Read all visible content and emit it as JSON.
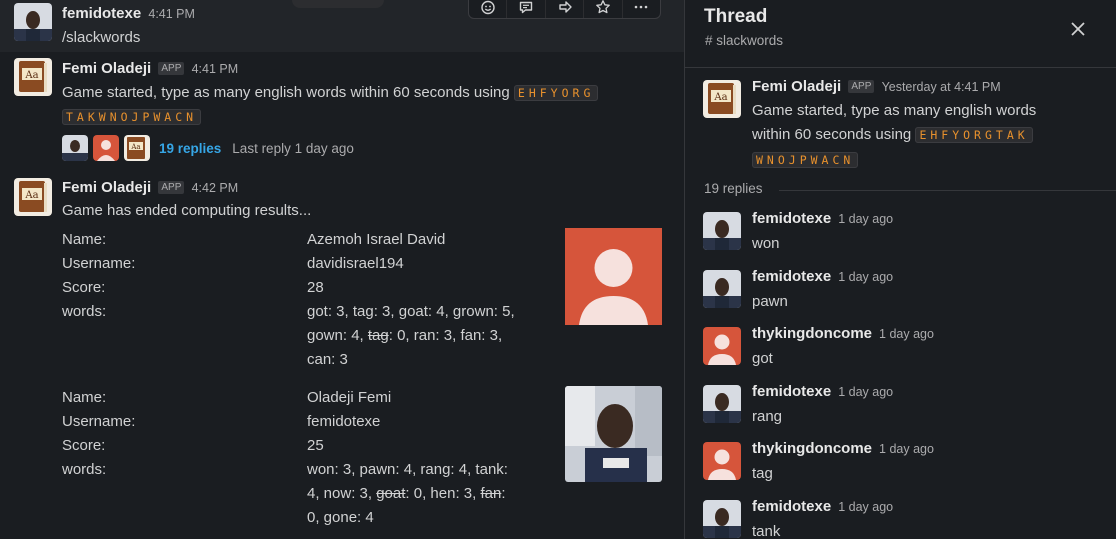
{
  "channel_messages": [
    {
      "sender": "femidotexe",
      "timestamp": "4:41 PM",
      "text": "/slackwords"
    },
    {
      "sender": "Femi Oladeji",
      "badge": "APP",
      "timestamp": "4:41 PM",
      "text": "Game started, type as many english words within 60 seconds using",
      "letters_line1": "EHFYORG",
      "letters_line2": "TAKWNOJPWACN",
      "replies_label": "19 replies",
      "last_reply": "Last reply 1 day ago"
    },
    {
      "sender": "Femi Oladeji",
      "badge": "APP",
      "timestamp": "4:42 PM",
      "text": "Game has ended computing results..."
    }
  ],
  "results": [
    {
      "name_label": "Name:",
      "username_label": "Username:",
      "score_label": "Score:",
      "words_label": "words:",
      "name": "Azemoh Israel David",
      "username": "davidisrael194",
      "score": "28",
      "words_l1": "got: 3, tag: 3, goat: 4, grown: 5,",
      "words_l2a": "gown: 4, ",
      "words_l2_strike": "tag",
      "words_l2b": ": 0, ran: 3, fan: 3,",
      "words_l3": "can: 3"
    },
    {
      "name_label": "Name:",
      "username_label": "Username:",
      "score_label": "Score:",
      "words_label": "words:",
      "name": "Oladeji Femi",
      "username": "femidotexe",
      "score": "25",
      "words_l1": "won: 3, pawn: 4, rang: 4, tank:",
      "words_l2a": "4, now: 3, ",
      "words_l2_strike": "goat",
      "words_l2b": ": 0, hen: 3, ",
      "words_l2_strike2": "fan",
      "words_l2c": ":",
      "words_l3": "0, gone: 4"
    }
  ],
  "thread": {
    "title": "Thread",
    "channel": "# slackwords",
    "parent": {
      "sender": "Femi Oladeji",
      "badge": "APP",
      "timestamp": "Yesterday at 4:41 PM",
      "text_l1": "Game started, type as many english words",
      "text_l2": "within 60 seconds using",
      "letters_line1": "EHFYORGTAK",
      "letters_line2": "WNOJPWACN"
    },
    "replies_count": "19 replies",
    "replies": [
      {
        "sender": "femidotexe",
        "timestamp": "1 day ago",
        "text": "won",
        "avatar": "photo"
      },
      {
        "sender": "femidotexe",
        "timestamp": "1 day ago",
        "text": "pawn",
        "avatar": "photo"
      },
      {
        "sender": "thykingdoncome",
        "timestamp": "1 day ago",
        "text": "got",
        "avatar": "default"
      },
      {
        "sender": "femidotexe",
        "timestamp": "1 day ago",
        "text": "rang",
        "avatar": "photo"
      },
      {
        "sender": "thykingdoncome",
        "timestamp": "1 day ago",
        "text": "tag",
        "avatar": "default"
      },
      {
        "sender": "femidotexe",
        "timestamp": "1 day ago",
        "text": "tank",
        "avatar": "photo"
      }
    ]
  },
  "colors": {
    "background": "#1a1d21",
    "link": "#36a6e6",
    "code_text": "#e8912d",
    "default_avatar": "#d6553b"
  },
  "icons": [
    "emoji-reaction-icon",
    "reply-in-thread-icon",
    "share-icon",
    "star-icon",
    "more-actions-icon",
    "close-icon"
  ]
}
